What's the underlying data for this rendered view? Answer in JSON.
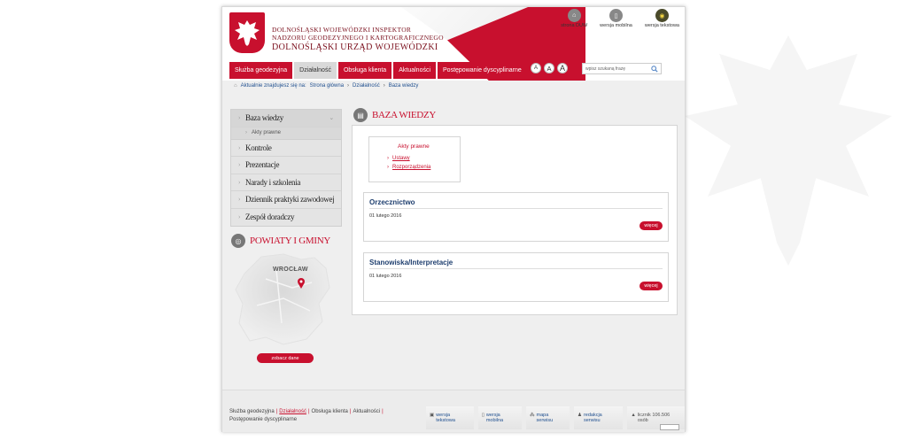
{
  "header": {
    "org_line1": "DOLNOŚLĄSKI WOJEWÓDZKI INSPEKTOR",
    "org_line2": "NADZORU GEODEZYJNEGO I KARTOGRAFICZNEGO",
    "org_line3": "DOLNOŚLĄSKI URZĄD WOJEWÓDZKI",
    "toplinks": [
      {
        "label": "strona DUW",
        "icon": "home-icon"
      },
      {
        "label": "wersja mobilna",
        "icon": "mobile-icon"
      },
      {
        "label": "wersja tekstowa",
        "icon": "text-version-icon"
      }
    ],
    "font_sizes": [
      "A",
      "A",
      "A"
    ],
    "search_placeholder": "wpisz szukaną frazę"
  },
  "nav": [
    {
      "label": "Służba geodezyjna",
      "active": false
    },
    {
      "label": "Działalność",
      "active": true
    },
    {
      "label": "Obsługa klienta",
      "active": false
    },
    {
      "label": "Aktualności",
      "active": false
    },
    {
      "label": "Postępowanie dyscyplinarne",
      "active": false
    }
  ],
  "breadcrumb": {
    "prefix": "Aktualnie znajdujesz się na:",
    "items": [
      "Strona główna",
      "Działalność",
      "Baza wiedzy"
    ]
  },
  "sidebar": {
    "items": [
      {
        "label": "Baza wiedzy"
      },
      {
        "label": "Kontrole"
      },
      {
        "label": "Prezentacje"
      },
      {
        "label": "Narady i szkolenia"
      },
      {
        "label": "Dziennik praktyki zawodowej"
      },
      {
        "label": "Zespół doradczy"
      }
    ],
    "subitem": "Akty prawne"
  },
  "powiaty": {
    "title": "POWIATY I GMINY",
    "city": "WROCŁAW",
    "button": "zobacz dane"
  },
  "main": {
    "title": "BAZA WIEDZY",
    "acts": {
      "title": "Akty prawne",
      "links": [
        "Ustawy",
        "Rozporządzenia"
      ]
    },
    "cards": [
      {
        "title": "Orzecznictwo",
        "date": "01 lutego 2016",
        "more": "więcej"
      },
      {
        "title": "Stanowiska/Interpretacje",
        "date": "01 lutego 2016",
        "more": "więcej"
      }
    ]
  },
  "footer": {
    "links": [
      "Służba geodezyjna",
      "Działalność",
      "Obsługa klienta",
      "Aktualności",
      "Postępowanie dyscyplinarne"
    ],
    "buttons": [
      {
        "label": "wersja tekstowa",
        "icon": "text-version-icon"
      },
      {
        "label": "wersja mobilna",
        "icon": "mobile-icon"
      },
      {
        "label": "mapa serwisu",
        "icon": "sitemap-icon"
      },
      {
        "label": "redakcja serwisu",
        "icon": "person-icon"
      },
      {
        "label": "licznik 106.506 osób",
        "icon": "counter-icon"
      }
    ]
  },
  "colors": {
    "accent": "#c8102e",
    "link": "#1f4f8f",
    "bg": "#efefef"
  }
}
